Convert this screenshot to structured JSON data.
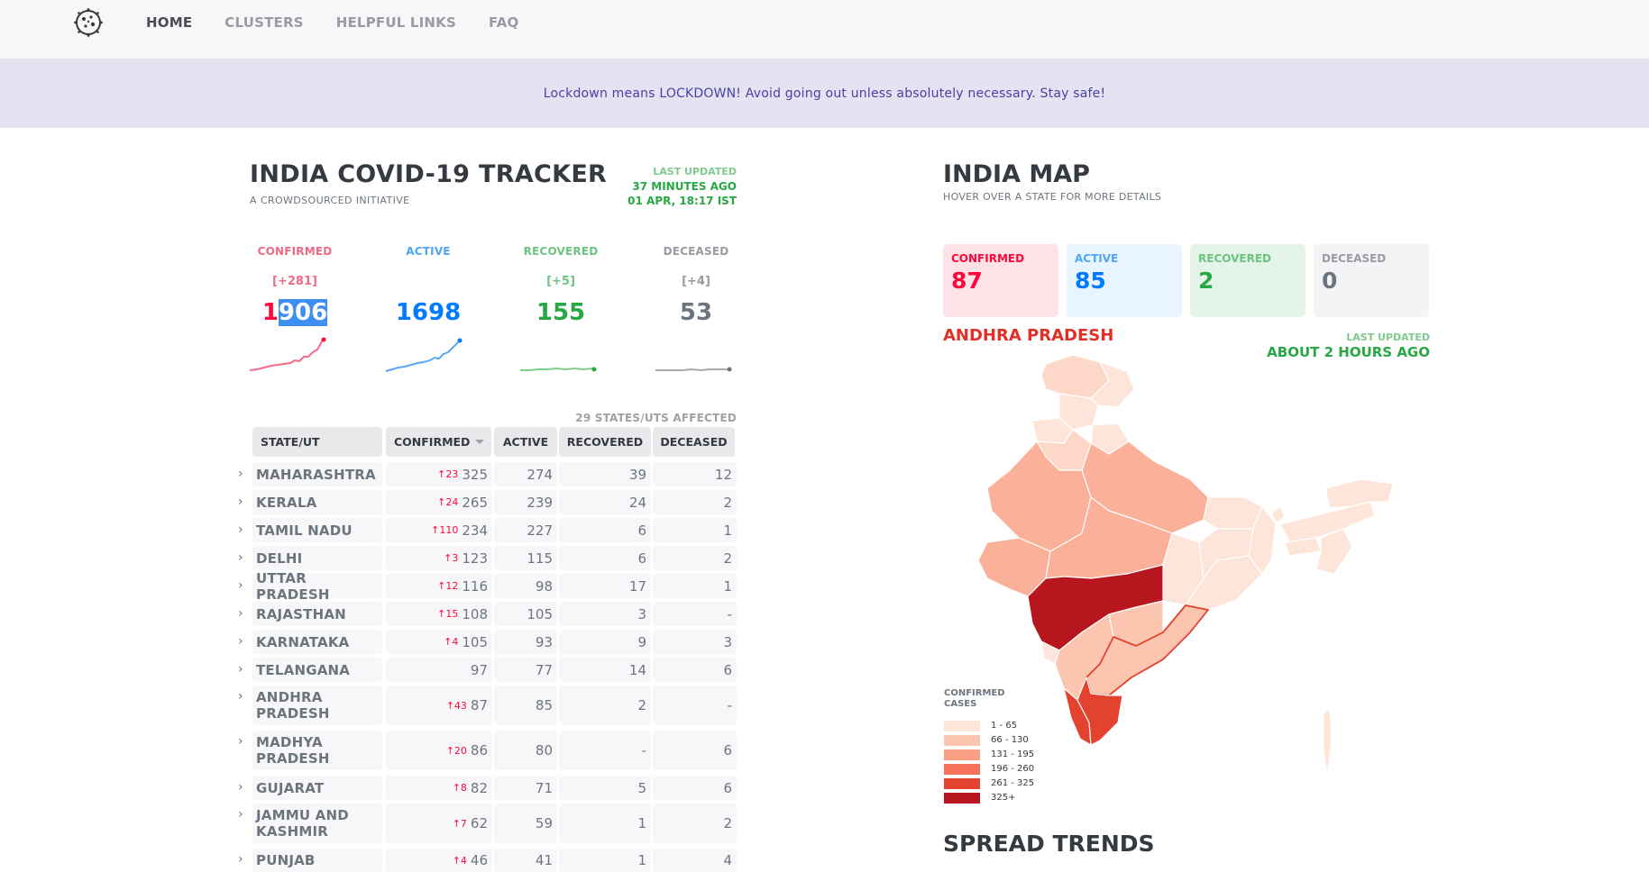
{
  "nav": {
    "items": [
      {
        "label": "HOME",
        "active": true
      },
      {
        "label": "CLUSTERS"
      },
      {
        "label": "HELPFUL LINKS"
      },
      {
        "label": "FAQ"
      }
    ]
  },
  "banner": {
    "text": "Lockdown means LOCKDOWN! Avoid going out unless absolutely necessary. Stay safe!"
  },
  "tracker": {
    "title": "INDIA COVID-19 TRACKER",
    "subtitle": "A CROWDSOURCED INITIATIVE",
    "last_updated_label": "LAST UPDATED",
    "last_updated_ago": "37 MINUTES AGO",
    "last_updated_date": "01 APR, 18:17 IST",
    "level": {
      "confirmed": {
        "label": "CONFIRMED",
        "delta": "[+281]",
        "value_a": "1",
        "value_b": "906",
        "color": "#ff073a"
      },
      "active": {
        "label": "ACTIVE",
        "delta": "",
        "value": "1698",
        "color": "#007bff"
      },
      "recovered": {
        "label": "RECOVERED",
        "delta": "[+5]",
        "value": "155",
        "color": "#28a745"
      },
      "deceased": {
        "label": "DECEASED",
        "delta": "[+4]",
        "value": "53",
        "color": "#6c757d"
      }
    },
    "affected": "29 STATES/UTS AFFECTED"
  },
  "table": {
    "headers": [
      "STATE/UT",
      "CONFIRMED",
      "ACTIVE",
      "RECOVERED",
      "DECEASED"
    ],
    "rows": [
      {
        "state": "MAHARASHTRA",
        "delta": "↑23",
        "confirmed": "325",
        "active": "274",
        "recovered": "39",
        "deceased": "12"
      },
      {
        "state": "KERALA",
        "delta": "↑24",
        "confirmed": "265",
        "active": "239",
        "recovered": "24",
        "deceased": "2"
      },
      {
        "state": "TAMIL NADU",
        "delta": "↑110",
        "confirmed": "234",
        "active": "227",
        "recovered": "6",
        "deceased": "1"
      },
      {
        "state": "DELHI",
        "delta": "↑3",
        "confirmed": "123",
        "active": "115",
        "recovered": "6",
        "deceased": "2"
      },
      {
        "state": "UTTAR PRADESH",
        "delta": "↑12",
        "confirmed": "116",
        "active": "98",
        "recovered": "17",
        "deceased": "1"
      },
      {
        "state": "RAJASTHAN",
        "delta": "↑15",
        "confirmed": "108",
        "active": "105",
        "recovered": "3",
        "deceased": "-"
      },
      {
        "state": "KARNATAKA",
        "delta": "↑4",
        "confirmed": "105",
        "active": "93",
        "recovered": "9",
        "deceased": "3"
      },
      {
        "state": "TELANGANA",
        "delta": "",
        "confirmed": "97",
        "active": "77",
        "recovered": "14",
        "deceased": "6"
      },
      {
        "state": "ANDHRA PRADESH",
        "delta": "↑43",
        "confirmed": "87",
        "active": "85",
        "recovered": "2",
        "deceased": "-"
      },
      {
        "state": "MADHYA PRADESH",
        "delta": "↑20",
        "confirmed": "86",
        "active": "80",
        "recovered": "-",
        "deceased": "6"
      },
      {
        "state": "GUJARAT",
        "delta": "↑8",
        "confirmed": "82",
        "active": "71",
        "recovered": "5",
        "deceased": "6"
      },
      {
        "state": "JAMMU AND KASHMIR",
        "delta": "↑7",
        "confirmed": "62",
        "active": "59",
        "recovered": "1",
        "deceased": "2"
      },
      {
        "state": "PUNJAB",
        "delta": "↑4",
        "confirmed": "46",
        "active": "41",
        "recovered": "1",
        "deceased": "4"
      }
    ]
  },
  "map": {
    "title": "INDIA MAP",
    "subtitle": "HOVER OVER A STATE FOR MORE DETAILS",
    "boxes": [
      {
        "label": "CONFIRMED",
        "value": "87",
        "bg": "#fde2e7",
        "color": "#ff073a"
      },
      {
        "label": "ACTIVE",
        "value": "85",
        "bg": "#e8f4ff",
        "color": "#007bff"
      },
      {
        "label": "RECOVERED",
        "value": "2",
        "bg": "#e4f4e8",
        "color": "#28a745"
      },
      {
        "label": "DECEASED",
        "value": "0",
        "bg": "#f4f4f6",
        "color": "#6c757d"
      }
    ],
    "state": "ANDHRA PRADESH",
    "last_updated_label": "LAST UPDATED",
    "last_updated_value": "ABOUT 2 HOURS AGO",
    "legend": {
      "title_1": "CONFIRMED",
      "title_2": "CASES",
      "items": [
        {
          "label": "1 - 65",
          "color": "#fee5d9"
        },
        {
          "label": "66 - 130",
          "color": "#fcc5b0"
        },
        {
          "label": "131 - 195",
          "color": "#fb9f84"
        },
        {
          "label": "196 - 260",
          "color": "#f6705a"
        },
        {
          "label": "261 - 325",
          "color": "#e3432e"
        },
        {
          "label": "325+",
          "color": "#b8161e"
        }
      ]
    }
  },
  "spread": {
    "title": "SPREAD TRENDS"
  }
}
